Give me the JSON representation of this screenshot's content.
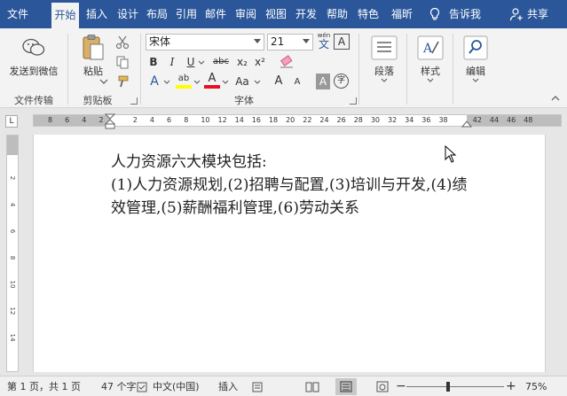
{
  "tabs": [
    {
      "label": "文件"
    },
    {
      "label": "开始"
    },
    {
      "label": "插入"
    },
    {
      "label": "设计"
    },
    {
      "label": "布局"
    },
    {
      "label": "引用"
    },
    {
      "label": "邮件"
    },
    {
      "label": "审阅"
    },
    {
      "label": "视图"
    },
    {
      "label": "开发"
    },
    {
      "label": "帮助"
    },
    {
      "label": "特色"
    },
    {
      "label": "福昕"
    }
  ],
  "tell_me": "告诉我",
  "share": "共享",
  "ribbon": {
    "send_wechat": "发送到微信",
    "group_file_transfer": "文件传输",
    "paste": "粘贴",
    "group_clipboard": "剪贴板",
    "font_name": "宋体",
    "font_size": "21",
    "wen_label": "wén",
    "wen_char": "文",
    "bold": "B",
    "italic": "I",
    "underline": "U",
    "strike": "abc",
    "subscript": "x₂",
    "superscript": "x²",
    "text_effects": "A",
    "highlight": "ab",
    "font_color": "A",
    "change_case": "Aa",
    "grow": "A",
    "shrink": "A",
    "char_shading": "A",
    "enclose_char": "字",
    "border_char": "A",
    "group_font": "字体",
    "paragraph": "段落",
    "styles": "样式",
    "editing": "编辑"
  },
  "ruler": {
    "tab_selector": "L",
    "numbers": [
      "8",
      "6",
      "4",
      "2",
      "",
      "2",
      "4",
      "6",
      "8",
      "10",
      "12",
      "14",
      "16",
      "18",
      "20",
      "22",
      "24",
      "26",
      "28",
      "30",
      "32",
      "34",
      "36",
      "38",
      "",
      "42",
      "44",
      "46",
      "48"
    ],
    "vnumbers": [
      "2",
      "4",
      "6",
      "8",
      "10",
      "12",
      "14"
    ]
  },
  "document": {
    "line1": "人力资源六大模块包括:",
    "line2": "(1)人力资源规划,(2)招聘与配置,(3)培训与开发,(4)绩效管理,(5)薪酬福利管理,(6)劳动关系"
  },
  "status": {
    "page": "第 1 页，共 1 页",
    "words": "47 个字",
    "language": "中文(中国)",
    "mode": "插入",
    "zoom": "75%"
  },
  "colors": {
    "brand": "#2b579a",
    "highlight": "#ffff00",
    "font_color": "#e81123"
  }
}
